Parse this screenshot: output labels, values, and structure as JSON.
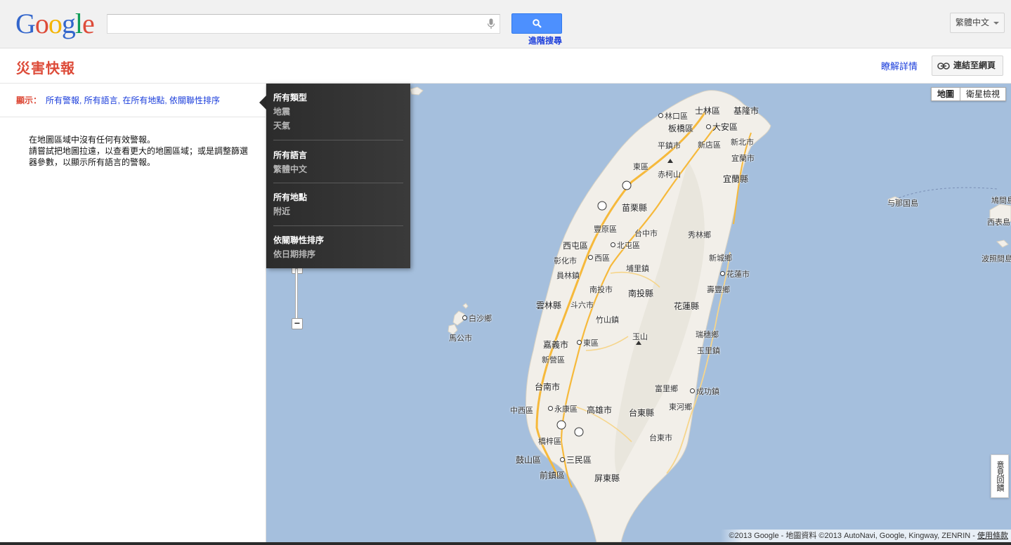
{
  "header": {
    "logo_letters": [
      {
        "ch": "G",
        "color": "#3366cc"
      },
      {
        "ch": "o",
        "color": "#dd4b39"
      },
      {
        "ch": "o",
        "color": "#f4b400"
      },
      {
        "ch": "g",
        "color": "#3366cc"
      },
      {
        "ch": "l",
        "color": "#109d58"
      },
      {
        "ch": "e",
        "color": "#dd4b39"
      }
    ],
    "search_value": "",
    "advanced_search": "進階搜尋",
    "language": "繁體中文"
  },
  "titlebar": {
    "title": "災害快報",
    "learn_more": "瞭解詳情",
    "link_to_page": "連結至網頁"
  },
  "filter": {
    "label": "顯示：",
    "value": "所有警報, 所有語言, 在所有地點, 依關聯性排序"
  },
  "notice": {
    "line1": "在地圖區域中沒有任何有效警報。",
    "line2": "請嘗試把地圖拉遠，以查看更大的地圖區域；或是調整篩選器參數，以顯示所有語言的警報。"
  },
  "dropdown": {
    "sections": [
      {
        "head": "所有類型",
        "items": [
          "地震",
          "天氣"
        ]
      },
      {
        "head": "所有語言",
        "items": [
          "繁體中文"
        ]
      },
      {
        "head": "所有地點",
        "items": [
          "附近"
        ]
      },
      {
        "head": "依關聯性排序",
        "items": [
          "依日期排序"
        ]
      }
    ]
  },
  "map": {
    "map_type": {
      "map": "地圖",
      "satellite": "衛星檢視"
    },
    "zoom_in": "+",
    "zoom_out": "−",
    "side_tab": "意見回饋",
    "copyright": "©2013 Google - 地圖資料 ©2013 AutoNavi, Google, Kingway, ZENRIN - ",
    "terms": "使用條款",
    "colors": {
      "water": "#a5bfdd",
      "land": "#f2efe9",
      "road": "#f6b93b"
    },
    "places": [
      {
        "name": "林口區",
        "dot": true,
        "big": false
      },
      {
        "name": "士林區",
        "dot": false,
        "big": true
      },
      {
        "name": "基隆市",
        "dot": false,
        "big": true
      },
      {
        "name": "板橋區",
        "dot": false,
        "big": true
      },
      {
        "name": "大安區",
        "dot": true,
        "big": true
      },
      {
        "name": "平鎮市",
        "dot": false,
        "big": false
      },
      {
        "name": "新店區",
        "dot": false,
        "big": false
      },
      {
        "name": "新北市",
        "dot": false,
        "big": false
      },
      {
        "name": "東區",
        "dot": false,
        "big": false
      },
      {
        "name": "赤柯山",
        "dot": false,
        "big": false
      },
      {
        "name": "宜蘭市",
        "dot": false,
        "big": false
      },
      {
        "name": "宜蘭縣",
        "dot": false,
        "big": true
      },
      {
        "name": "苗栗縣",
        "dot": false,
        "big": true
      },
      {
        "name": "豐原區",
        "dot": false,
        "big": false
      },
      {
        "name": "台中市",
        "dot": false,
        "big": false
      },
      {
        "name": "秀林鄉",
        "dot": false,
        "big": false
      },
      {
        "name": "西屯區",
        "dot": false,
        "big": true
      },
      {
        "name": "北屯區",
        "dot": true,
        "big": false
      },
      {
        "name": "彰化市",
        "dot": false,
        "big": false
      },
      {
        "name": "西區",
        "dot": true,
        "big": false
      },
      {
        "name": "新城鄉",
        "dot": false,
        "big": false
      },
      {
        "name": "埔里鎮",
        "dot": false,
        "big": false
      },
      {
        "name": "員林鎮",
        "dot": false,
        "big": false
      },
      {
        "name": "花蓮市",
        "dot": true,
        "big": false
      },
      {
        "name": "南投市",
        "dot": false,
        "big": false
      },
      {
        "name": "南投縣",
        "dot": false,
        "big": true
      },
      {
        "name": "壽豐鄉",
        "dot": false,
        "big": false
      },
      {
        "name": "雲林縣",
        "dot": false,
        "big": true
      },
      {
        "name": "斗六市",
        "dot": false,
        "big": false
      },
      {
        "name": "花蓮縣",
        "dot": false,
        "big": true
      },
      {
        "name": "竹山鎮",
        "dot": false,
        "big": false
      },
      {
        "name": "玉山",
        "dot": false,
        "big": false
      },
      {
        "name": "瑞穗鄉",
        "dot": false,
        "big": false
      },
      {
        "name": "嘉義市",
        "dot": false,
        "big": true
      },
      {
        "name": "東區",
        "dot": true,
        "big": false
      },
      {
        "name": "玉里鎮",
        "dot": false,
        "big": false
      },
      {
        "name": "新營區",
        "dot": false,
        "big": false
      },
      {
        "name": "富里鄉",
        "dot": false,
        "big": false
      },
      {
        "name": "成功鎮",
        "dot": true,
        "big": false
      },
      {
        "name": "台南市",
        "dot": false,
        "big": true
      },
      {
        "name": "東河鄉",
        "dot": false,
        "big": false
      },
      {
        "name": "中西區",
        "dot": false,
        "big": false
      },
      {
        "name": "永康區",
        "dot": true,
        "big": false
      },
      {
        "name": "高雄市",
        "dot": false,
        "big": true
      },
      {
        "name": "台東縣",
        "dot": false,
        "big": true
      },
      {
        "name": "台東市",
        "dot": false,
        "big": false
      },
      {
        "name": "橋梓區",
        "dot": false,
        "big": false
      },
      {
        "name": "鼓山區",
        "dot": false,
        "big": true
      },
      {
        "name": "三民區",
        "dot": true,
        "big": true
      },
      {
        "name": "前鎮區",
        "dot": false,
        "big": true
      },
      {
        "name": "屏東縣",
        "dot": false,
        "big": true
      },
      {
        "name": "白沙鄉",
        "dot": true,
        "big": false
      },
      {
        "name": "馬公市",
        "dot": false,
        "big": false
      },
      {
        "name": "与那国島",
        "dot": false,
        "big": false
      },
      {
        "name": "鳩間島",
        "dot": false,
        "big": false
      },
      {
        "name": "西表島",
        "dot": false,
        "big": false
      },
      {
        "name": "波照間島",
        "dot": false,
        "big": false
      }
    ]
  }
}
